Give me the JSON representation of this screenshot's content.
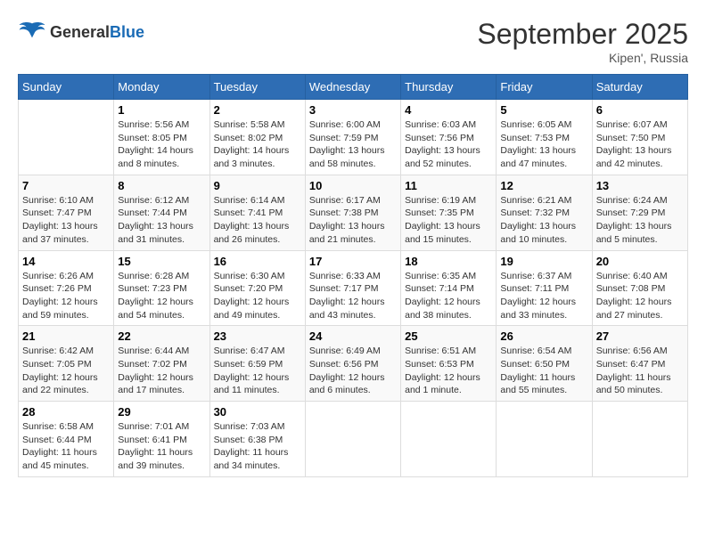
{
  "header": {
    "logo": {
      "general": "General",
      "blue": "Blue"
    },
    "title": "September 2025",
    "location": "Kipen', Russia"
  },
  "weekdays": [
    "Sunday",
    "Monday",
    "Tuesday",
    "Wednesday",
    "Thursday",
    "Friday",
    "Saturday"
  ],
  "weeks": [
    [
      {
        "day": "",
        "info": ""
      },
      {
        "day": "1",
        "info": "Sunrise: 5:56 AM\nSunset: 8:05 PM\nDaylight: 14 hours\nand 8 minutes."
      },
      {
        "day": "2",
        "info": "Sunrise: 5:58 AM\nSunset: 8:02 PM\nDaylight: 14 hours\nand 3 minutes."
      },
      {
        "day": "3",
        "info": "Sunrise: 6:00 AM\nSunset: 7:59 PM\nDaylight: 13 hours\nand 58 minutes."
      },
      {
        "day": "4",
        "info": "Sunrise: 6:03 AM\nSunset: 7:56 PM\nDaylight: 13 hours\nand 52 minutes."
      },
      {
        "day": "5",
        "info": "Sunrise: 6:05 AM\nSunset: 7:53 PM\nDaylight: 13 hours\nand 47 minutes."
      },
      {
        "day": "6",
        "info": "Sunrise: 6:07 AM\nSunset: 7:50 PM\nDaylight: 13 hours\nand 42 minutes."
      }
    ],
    [
      {
        "day": "7",
        "info": "Sunrise: 6:10 AM\nSunset: 7:47 PM\nDaylight: 13 hours\nand 37 minutes."
      },
      {
        "day": "8",
        "info": "Sunrise: 6:12 AM\nSunset: 7:44 PM\nDaylight: 13 hours\nand 31 minutes."
      },
      {
        "day": "9",
        "info": "Sunrise: 6:14 AM\nSunset: 7:41 PM\nDaylight: 13 hours\nand 26 minutes."
      },
      {
        "day": "10",
        "info": "Sunrise: 6:17 AM\nSunset: 7:38 PM\nDaylight: 13 hours\nand 21 minutes."
      },
      {
        "day": "11",
        "info": "Sunrise: 6:19 AM\nSunset: 7:35 PM\nDaylight: 13 hours\nand 15 minutes."
      },
      {
        "day": "12",
        "info": "Sunrise: 6:21 AM\nSunset: 7:32 PM\nDaylight: 13 hours\nand 10 minutes."
      },
      {
        "day": "13",
        "info": "Sunrise: 6:24 AM\nSunset: 7:29 PM\nDaylight: 13 hours\nand 5 minutes."
      }
    ],
    [
      {
        "day": "14",
        "info": "Sunrise: 6:26 AM\nSunset: 7:26 PM\nDaylight: 12 hours\nand 59 minutes."
      },
      {
        "day": "15",
        "info": "Sunrise: 6:28 AM\nSunset: 7:23 PM\nDaylight: 12 hours\nand 54 minutes."
      },
      {
        "day": "16",
        "info": "Sunrise: 6:30 AM\nSunset: 7:20 PM\nDaylight: 12 hours\nand 49 minutes."
      },
      {
        "day": "17",
        "info": "Sunrise: 6:33 AM\nSunset: 7:17 PM\nDaylight: 12 hours\nand 43 minutes."
      },
      {
        "day": "18",
        "info": "Sunrise: 6:35 AM\nSunset: 7:14 PM\nDaylight: 12 hours\nand 38 minutes."
      },
      {
        "day": "19",
        "info": "Sunrise: 6:37 AM\nSunset: 7:11 PM\nDaylight: 12 hours\nand 33 minutes."
      },
      {
        "day": "20",
        "info": "Sunrise: 6:40 AM\nSunset: 7:08 PM\nDaylight: 12 hours\nand 27 minutes."
      }
    ],
    [
      {
        "day": "21",
        "info": "Sunrise: 6:42 AM\nSunset: 7:05 PM\nDaylight: 12 hours\nand 22 minutes."
      },
      {
        "day": "22",
        "info": "Sunrise: 6:44 AM\nSunset: 7:02 PM\nDaylight: 12 hours\nand 17 minutes."
      },
      {
        "day": "23",
        "info": "Sunrise: 6:47 AM\nSunset: 6:59 PM\nDaylight: 12 hours\nand 11 minutes."
      },
      {
        "day": "24",
        "info": "Sunrise: 6:49 AM\nSunset: 6:56 PM\nDaylight: 12 hours\nand 6 minutes."
      },
      {
        "day": "25",
        "info": "Sunrise: 6:51 AM\nSunset: 6:53 PM\nDaylight: 12 hours\nand 1 minute."
      },
      {
        "day": "26",
        "info": "Sunrise: 6:54 AM\nSunset: 6:50 PM\nDaylight: 11 hours\nand 55 minutes."
      },
      {
        "day": "27",
        "info": "Sunrise: 6:56 AM\nSunset: 6:47 PM\nDaylight: 11 hours\nand 50 minutes."
      }
    ],
    [
      {
        "day": "28",
        "info": "Sunrise: 6:58 AM\nSunset: 6:44 PM\nDaylight: 11 hours\nand 45 minutes."
      },
      {
        "day": "29",
        "info": "Sunrise: 7:01 AM\nSunset: 6:41 PM\nDaylight: 11 hours\nand 39 minutes."
      },
      {
        "day": "30",
        "info": "Sunrise: 7:03 AM\nSunset: 6:38 PM\nDaylight: 11 hours\nand 34 minutes."
      },
      {
        "day": "",
        "info": ""
      },
      {
        "day": "",
        "info": ""
      },
      {
        "day": "",
        "info": ""
      },
      {
        "day": "",
        "info": ""
      }
    ]
  ]
}
